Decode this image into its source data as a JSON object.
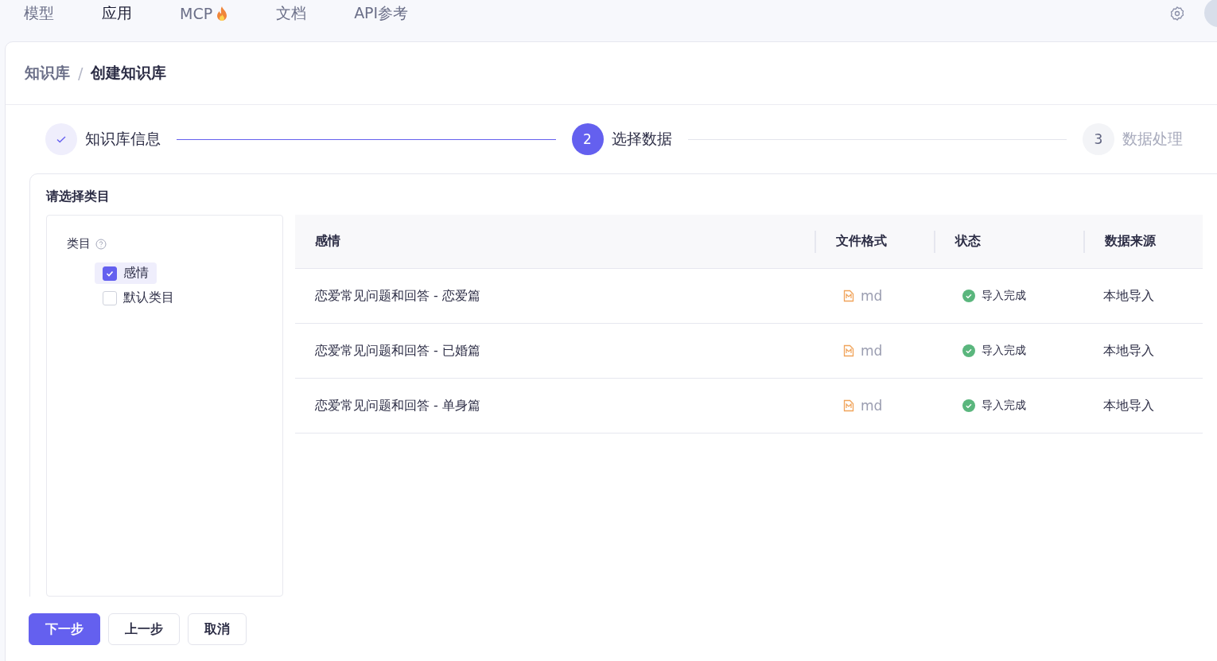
{
  "nav": {
    "tabs": [
      {
        "label": "模型",
        "selected": false,
        "hot": false
      },
      {
        "label": "应用",
        "selected": true,
        "hot": false
      },
      {
        "label": "MCP",
        "selected": false,
        "hot": true
      },
      {
        "label": "文档",
        "selected": false,
        "hot": false
      },
      {
        "label": "API参考",
        "selected": false,
        "hot": false
      }
    ]
  },
  "breadcrumb": {
    "separator": "/",
    "items": [
      "知识库",
      "创建知识库"
    ]
  },
  "steps": [
    {
      "label": "知识库信息",
      "done": true,
      "selected": false
    },
    {
      "label": "选择数据",
      "number": "2",
      "done": false,
      "selected": true
    },
    {
      "label": "数据处理",
      "number": "3",
      "done": false,
      "selected": false
    }
  ],
  "panel_title": "请选择类目",
  "category_tree": {
    "label": "类目",
    "items": [
      {
        "label": "感情",
        "checked": true,
        "selected": true
      },
      {
        "label": "默认类目",
        "checked": false,
        "selected": false
      }
    ]
  },
  "table": {
    "columns": [
      "感情",
      "文件格式",
      "状态",
      "数据来源"
    ],
    "rows": [
      {
        "name": "恋爱常见问题和回答 - 恋爱篇",
        "format": "md",
        "status": "导入完成",
        "source": "本地导入"
      },
      {
        "name": "恋爱常见问题和回答 - 已婚篇",
        "format": "md",
        "status": "导入完成",
        "source": "本地导入"
      },
      {
        "name": "恋爱常见问题和回答 - 单身篇",
        "format": "md",
        "status": "导入完成",
        "source": "本地导入"
      }
    ]
  },
  "buttons": [
    {
      "label": "下一步",
      "kind": "primary"
    },
    {
      "label": "上一步",
      "kind": "default"
    },
    {
      "label": "取消",
      "kind": "default"
    }
  ]
}
